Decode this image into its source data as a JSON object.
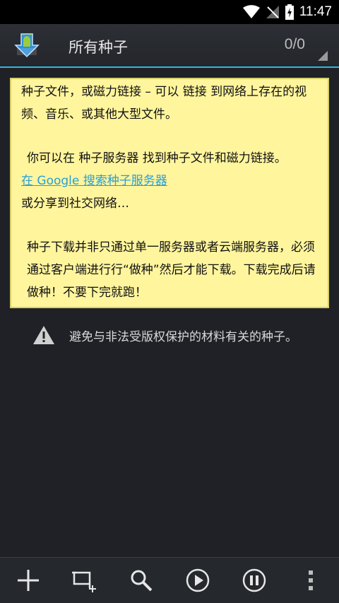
{
  "status_bar": {
    "time": "11:47"
  },
  "header": {
    "title": "所有种子",
    "count": "0/0"
  },
  "info_card": {
    "para1": "种子文件，或磁力链接 – 可以 链接 到网络上存在的视频、音乐、或其他大型文件。",
    "para2": "你可以在 种子服务器 找到种子文件和磁力链接。",
    "link_text": "在 Google 搜索种子服务器",
    "para3": "或分享到社交网络…",
    "para4": "种子下载并非只通过单一服务器或者云端服务器，必须通过客户端进行行“做种”然后才能下载。下载完成后请做种！不要下完就跑！"
  },
  "warning": {
    "text": "避免与非法受版权保护的材料有关的种子。"
  },
  "bottom_bar": {
    "buttons": [
      "add-icon",
      "add-files-icon",
      "search-icon",
      "play-icon",
      "pause-icon",
      "overflow-menu-icon"
    ]
  },
  "colors": {
    "accent": "#33b5e5",
    "note_bg": "#fff59d",
    "link": "#2a9fd6"
  }
}
